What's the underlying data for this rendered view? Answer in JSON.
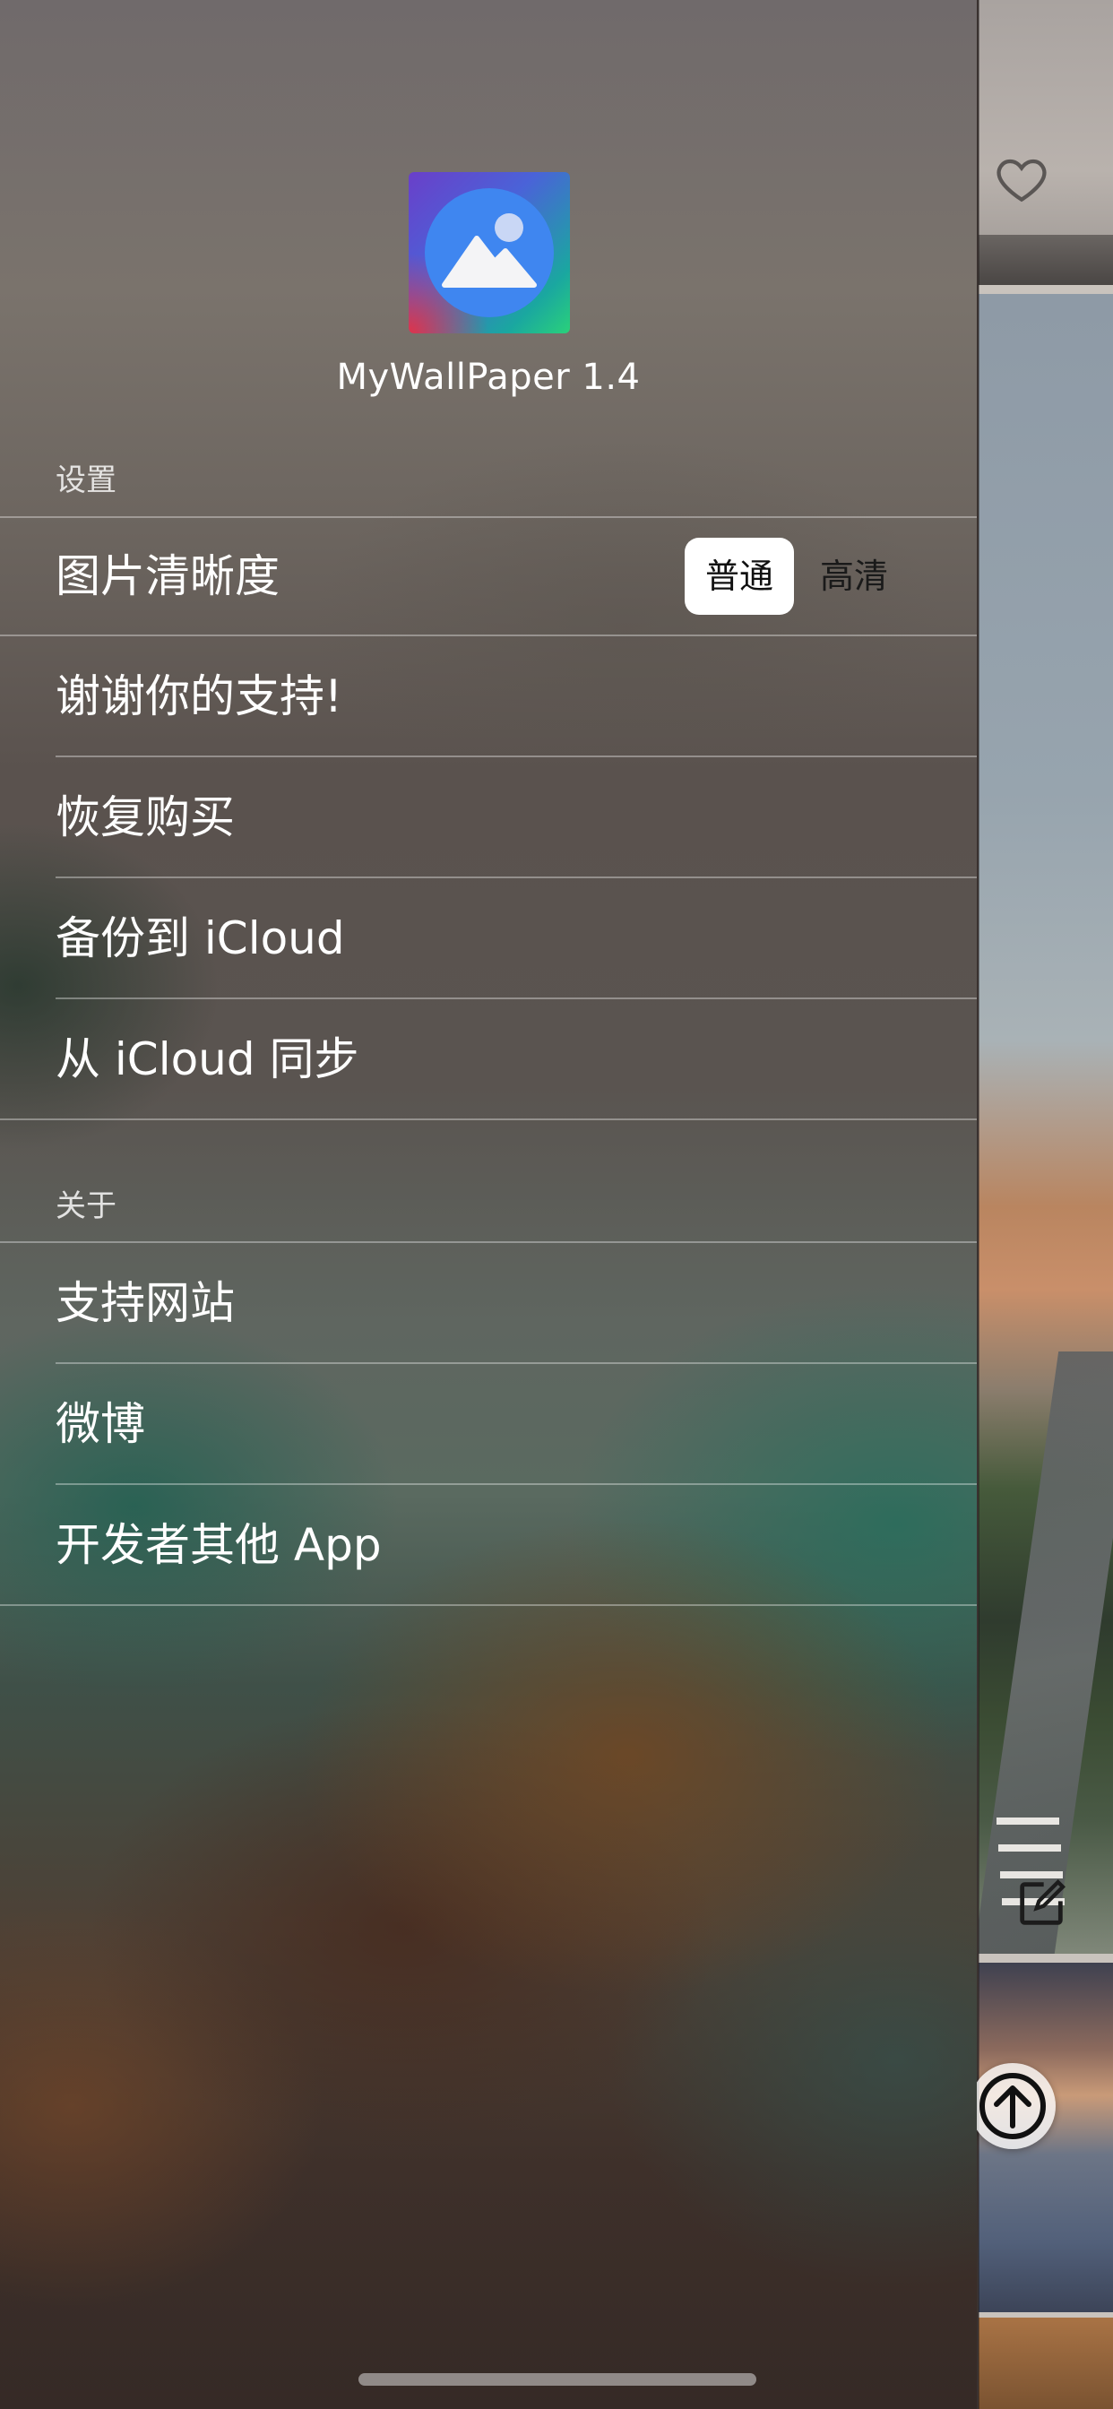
{
  "app": {
    "title": "MyWallPaper 1.4"
  },
  "settings": {
    "header": "设置",
    "image_quality": {
      "label": "图片清晰度",
      "options": [
        "普通",
        "高清"
      ],
      "selected": "普通"
    },
    "items": [
      {
        "label": "谢谢你的支持!"
      },
      {
        "label": "恢复购买"
      },
      {
        "label": "备份到 iCloud"
      },
      {
        "label": "从 iCloud 同步"
      }
    ]
  },
  "about": {
    "header": "关于",
    "items": [
      {
        "label": "支持网站"
      },
      {
        "label": "微博"
      },
      {
        "label": "开发者其他 App"
      }
    ]
  },
  "icons": {
    "app_logo": "mountain-photo-icon",
    "favorite": "heart-icon",
    "edit": "edit-icon",
    "scroll_top": "arrow-up-circle-icon"
  }
}
